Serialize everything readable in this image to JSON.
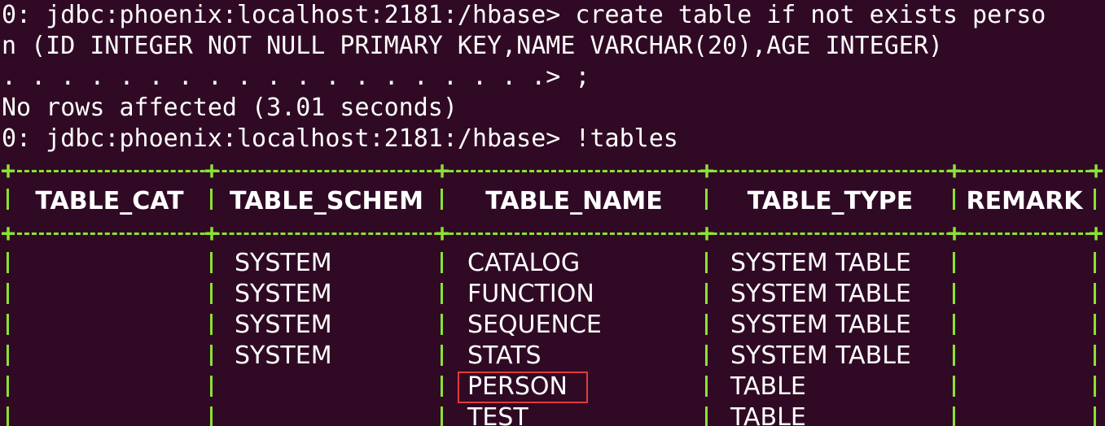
{
  "terminal": {
    "lines": [
      "0: jdbc:phoenix:localhost:2181:/hbase> create table if not exists perso",
      "n (ID INTEGER NOT NULL PRIMARY KEY,NAME VARCHAR(20),AGE INTEGER)",
      ". . . . . . . . . . . . . . . . . . .> ;",
      "No rows affected (3.01 seconds)",
      "0: jdbc:phoenix:localhost:2181:/hbase> !tables"
    ]
  },
  "table": {
    "headers": [
      "TABLE_CAT",
      "TABLE_SCHEM",
      "TABLE_NAME",
      "TABLE_TYPE",
      "REMARK"
    ],
    "rows": [
      {
        "cat": "",
        "schem": "SYSTEM",
        "name": "CATALOG",
        "type": "SYSTEM TABLE"
      },
      {
        "cat": "",
        "schem": "SYSTEM",
        "name": "FUNCTION",
        "type": "SYSTEM TABLE"
      },
      {
        "cat": "",
        "schem": "SYSTEM",
        "name": "SEQUENCE",
        "type": "SYSTEM TABLE"
      },
      {
        "cat": "",
        "schem": "SYSTEM",
        "name": "STATS",
        "type": "SYSTEM TABLE"
      },
      {
        "cat": "",
        "schem": "",
        "name": "PERSON",
        "type": "TABLE"
      },
      {
        "cat": "",
        "schem": "",
        "name": "TEST",
        "type": "TABLE"
      }
    ],
    "highlighted_row": "PERSON"
  },
  "colors": {
    "background": "#300a24",
    "text": "#ffffff",
    "border": "#8ae234",
    "highlight": "#e03c3c"
  }
}
